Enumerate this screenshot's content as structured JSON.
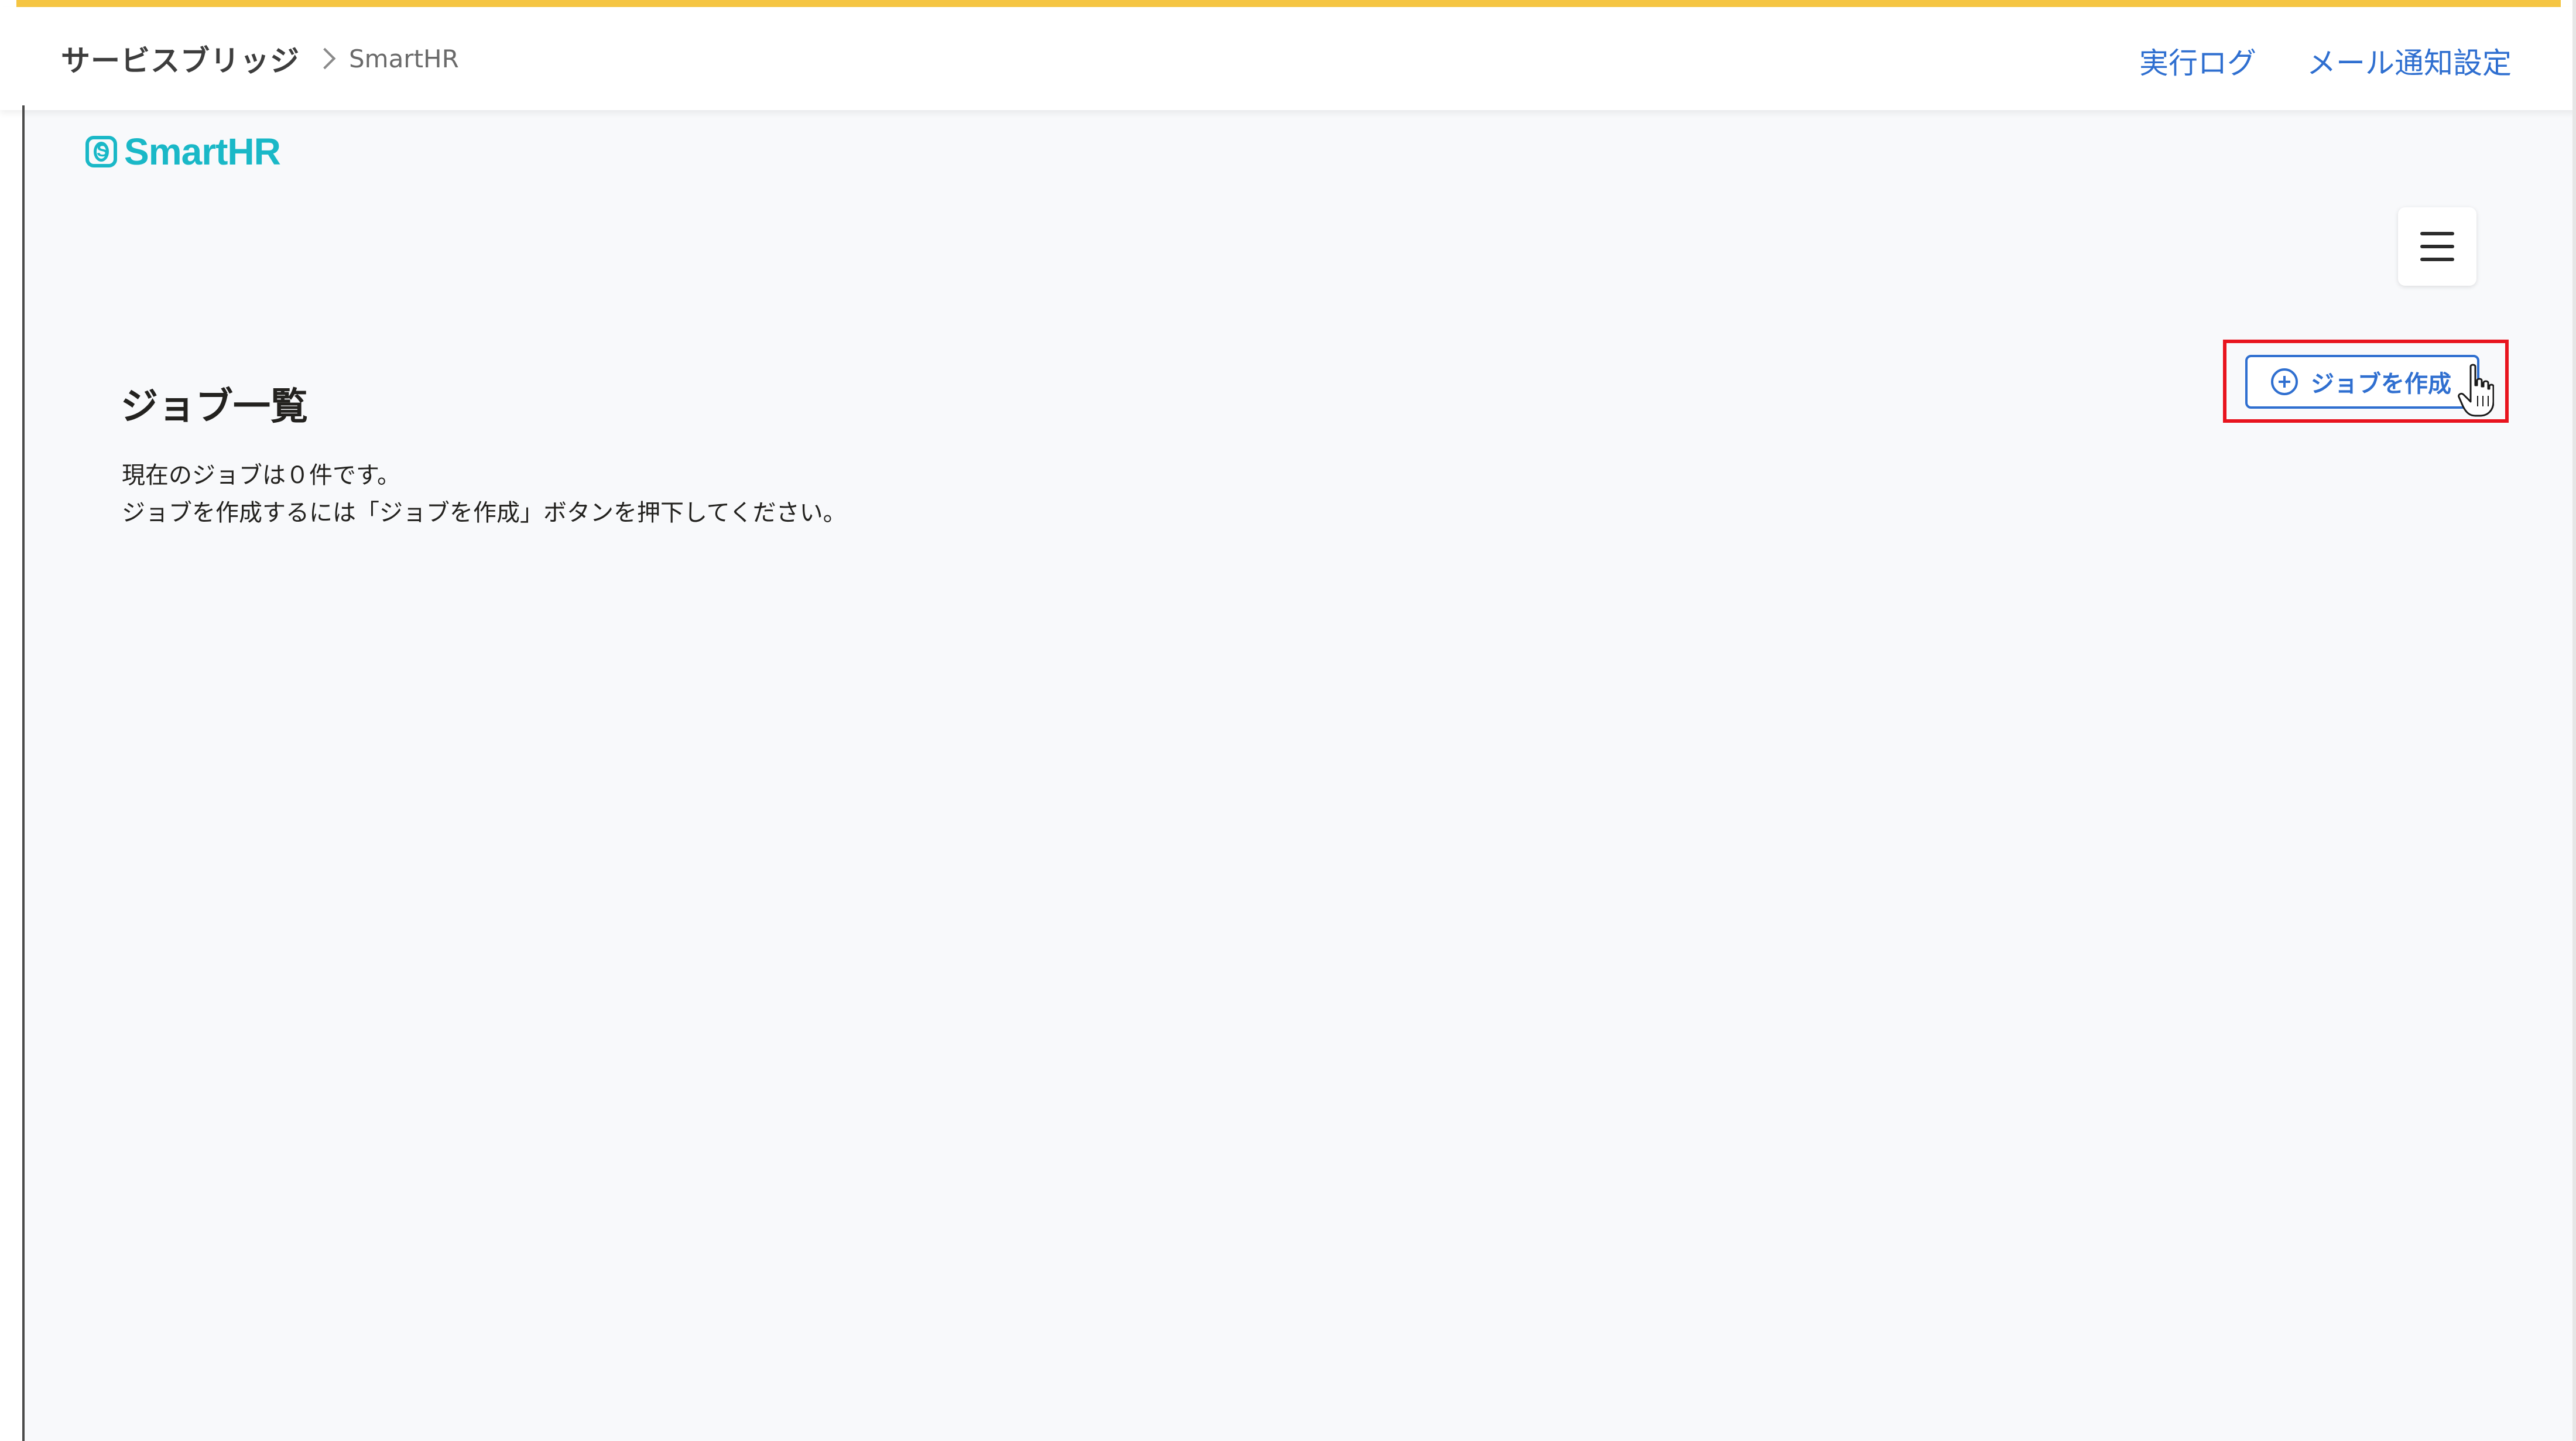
{
  "header": {
    "breadcrumb_root": "サービスブリッジ",
    "breadcrumb_current": "SmartHR",
    "links": {
      "execution_log": "実行ログ",
      "mail_settings": "メール通知設定"
    }
  },
  "app": {
    "logo_text": "SmartHR",
    "logo_badge_letter": "S",
    "brand_color": "#1ab8c7",
    "accent_color": "#2f6fd0",
    "highlight_color": "#e8141e"
  },
  "main": {
    "title": "ジョブ一覧",
    "create_button_label": "ジョブを作成",
    "message_line1": "現在のジョブは０件です。",
    "message_line2": "ジョブを作成するには「ジョブを作成」ボタンを押下してください。"
  },
  "icons": {
    "menu": "hamburger-menu-icon",
    "create": "plus-circle-icon",
    "cursor": "hand-pointer-cursor-icon",
    "separator": "chevron-right-icon"
  }
}
